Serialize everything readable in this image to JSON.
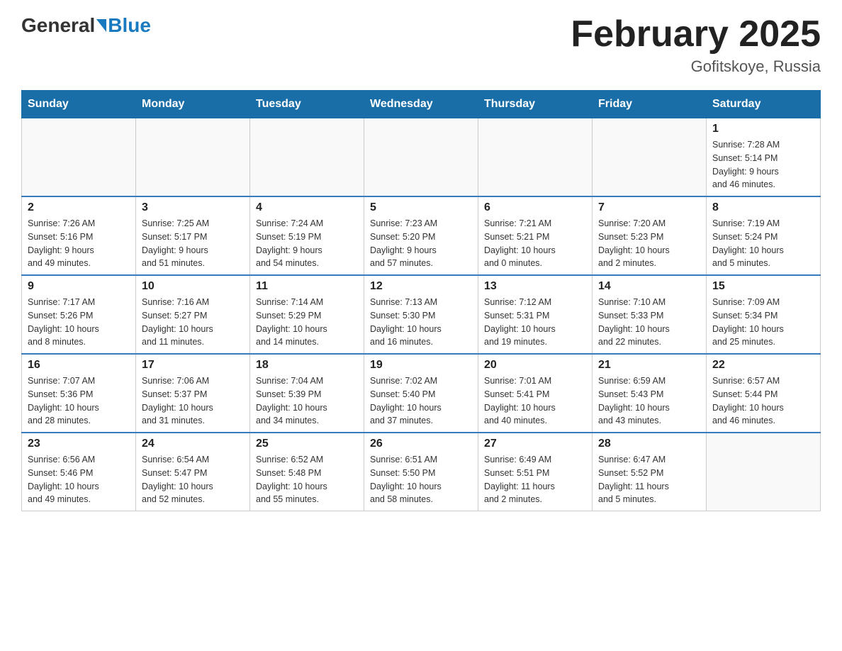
{
  "header": {
    "logo_general": "General",
    "logo_blue": "Blue",
    "main_title": "February 2025",
    "subtitle": "Gofitskoye, Russia"
  },
  "days_of_week": [
    "Sunday",
    "Monday",
    "Tuesday",
    "Wednesday",
    "Thursday",
    "Friday",
    "Saturday"
  ],
  "weeks": [
    [
      {
        "day": "",
        "info": ""
      },
      {
        "day": "",
        "info": ""
      },
      {
        "day": "",
        "info": ""
      },
      {
        "day": "",
        "info": ""
      },
      {
        "day": "",
        "info": ""
      },
      {
        "day": "",
        "info": ""
      },
      {
        "day": "1",
        "info": "Sunrise: 7:28 AM\nSunset: 5:14 PM\nDaylight: 9 hours\nand 46 minutes."
      }
    ],
    [
      {
        "day": "2",
        "info": "Sunrise: 7:26 AM\nSunset: 5:16 PM\nDaylight: 9 hours\nand 49 minutes."
      },
      {
        "day": "3",
        "info": "Sunrise: 7:25 AM\nSunset: 5:17 PM\nDaylight: 9 hours\nand 51 minutes."
      },
      {
        "day": "4",
        "info": "Sunrise: 7:24 AM\nSunset: 5:19 PM\nDaylight: 9 hours\nand 54 minutes."
      },
      {
        "day": "5",
        "info": "Sunrise: 7:23 AM\nSunset: 5:20 PM\nDaylight: 9 hours\nand 57 minutes."
      },
      {
        "day": "6",
        "info": "Sunrise: 7:21 AM\nSunset: 5:21 PM\nDaylight: 10 hours\nand 0 minutes."
      },
      {
        "day": "7",
        "info": "Sunrise: 7:20 AM\nSunset: 5:23 PM\nDaylight: 10 hours\nand 2 minutes."
      },
      {
        "day": "8",
        "info": "Sunrise: 7:19 AM\nSunset: 5:24 PM\nDaylight: 10 hours\nand 5 minutes."
      }
    ],
    [
      {
        "day": "9",
        "info": "Sunrise: 7:17 AM\nSunset: 5:26 PM\nDaylight: 10 hours\nand 8 minutes."
      },
      {
        "day": "10",
        "info": "Sunrise: 7:16 AM\nSunset: 5:27 PM\nDaylight: 10 hours\nand 11 minutes."
      },
      {
        "day": "11",
        "info": "Sunrise: 7:14 AM\nSunset: 5:29 PM\nDaylight: 10 hours\nand 14 minutes."
      },
      {
        "day": "12",
        "info": "Sunrise: 7:13 AM\nSunset: 5:30 PM\nDaylight: 10 hours\nand 16 minutes."
      },
      {
        "day": "13",
        "info": "Sunrise: 7:12 AM\nSunset: 5:31 PM\nDaylight: 10 hours\nand 19 minutes."
      },
      {
        "day": "14",
        "info": "Sunrise: 7:10 AM\nSunset: 5:33 PM\nDaylight: 10 hours\nand 22 minutes."
      },
      {
        "day": "15",
        "info": "Sunrise: 7:09 AM\nSunset: 5:34 PM\nDaylight: 10 hours\nand 25 minutes."
      }
    ],
    [
      {
        "day": "16",
        "info": "Sunrise: 7:07 AM\nSunset: 5:36 PM\nDaylight: 10 hours\nand 28 minutes."
      },
      {
        "day": "17",
        "info": "Sunrise: 7:06 AM\nSunset: 5:37 PM\nDaylight: 10 hours\nand 31 minutes."
      },
      {
        "day": "18",
        "info": "Sunrise: 7:04 AM\nSunset: 5:39 PM\nDaylight: 10 hours\nand 34 minutes."
      },
      {
        "day": "19",
        "info": "Sunrise: 7:02 AM\nSunset: 5:40 PM\nDaylight: 10 hours\nand 37 minutes."
      },
      {
        "day": "20",
        "info": "Sunrise: 7:01 AM\nSunset: 5:41 PM\nDaylight: 10 hours\nand 40 minutes."
      },
      {
        "day": "21",
        "info": "Sunrise: 6:59 AM\nSunset: 5:43 PM\nDaylight: 10 hours\nand 43 minutes."
      },
      {
        "day": "22",
        "info": "Sunrise: 6:57 AM\nSunset: 5:44 PM\nDaylight: 10 hours\nand 46 minutes."
      }
    ],
    [
      {
        "day": "23",
        "info": "Sunrise: 6:56 AM\nSunset: 5:46 PM\nDaylight: 10 hours\nand 49 minutes."
      },
      {
        "day": "24",
        "info": "Sunrise: 6:54 AM\nSunset: 5:47 PM\nDaylight: 10 hours\nand 52 minutes."
      },
      {
        "day": "25",
        "info": "Sunrise: 6:52 AM\nSunset: 5:48 PM\nDaylight: 10 hours\nand 55 minutes."
      },
      {
        "day": "26",
        "info": "Sunrise: 6:51 AM\nSunset: 5:50 PM\nDaylight: 10 hours\nand 58 minutes."
      },
      {
        "day": "27",
        "info": "Sunrise: 6:49 AM\nSunset: 5:51 PM\nDaylight: 11 hours\nand 2 minutes."
      },
      {
        "day": "28",
        "info": "Sunrise: 6:47 AM\nSunset: 5:52 PM\nDaylight: 11 hours\nand 5 minutes."
      },
      {
        "day": "",
        "info": ""
      }
    ]
  ]
}
